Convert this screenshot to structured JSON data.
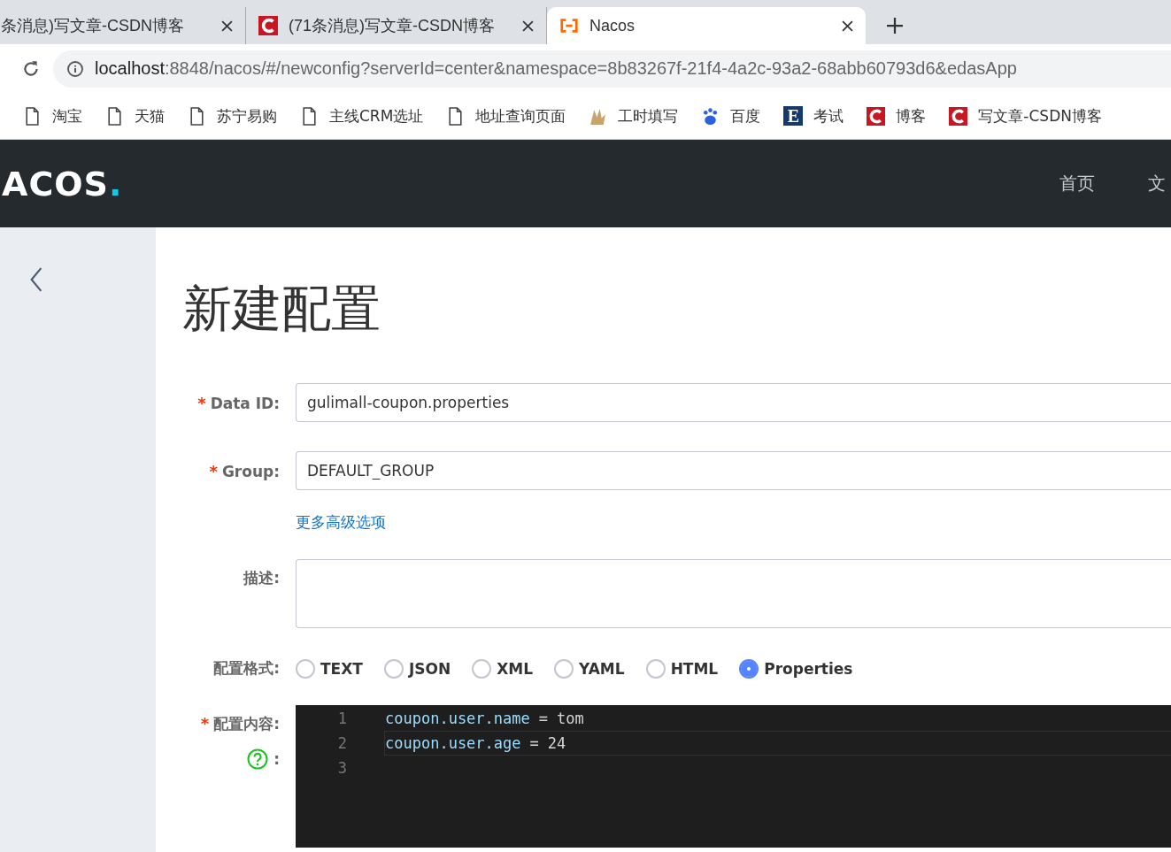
{
  "browser": {
    "tabs": [
      {
        "title": "条消息)写文章-CSDN博客",
        "kind": "plain",
        "selected": false
      },
      {
        "title": "(71条消息)写文章-CSDN博客",
        "kind": "csdn",
        "selected": false
      },
      {
        "title": "Nacos",
        "kind": "nacos",
        "selected": true
      }
    ],
    "address": {
      "host": "localhost",
      "path": ":8848/nacos/#/newconfig?serverId=center&namespace=8b83267f-21f4-4a2c-93a2-68abb60793d6&edasApp"
    },
    "bookmarks": [
      {
        "label": "淘宝",
        "kind": "page"
      },
      {
        "label": "天猫",
        "kind": "page"
      },
      {
        "label": "苏宁易购",
        "kind": "page"
      },
      {
        "label": "主线CRM选址",
        "kind": "page"
      },
      {
        "label": "地址查询页面",
        "kind": "page"
      },
      {
        "label": "工时填写",
        "kind": "artwork"
      },
      {
        "label": "百度",
        "kind": "paw"
      },
      {
        "label": "考试",
        "kind": "letter",
        "letter": "E"
      },
      {
        "label": "博客",
        "kind": "csdn"
      },
      {
        "label": "写文章-CSDN博客",
        "kind": "csdn"
      }
    ]
  },
  "header": {
    "logo": "ACOS",
    "logo_dot": ".",
    "nav": [
      "首页",
      "文"
    ]
  },
  "page": {
    "title": "新建配置",
    "fields": [
      {
        "label": "Data ID:",
        "required_mark": "*",
        "value": "gulimall-coupon.properties"
      },
      {
        "label": "Group:",
        "required_mark": "*",
        "value": "DEFAULT_GROUP"
      }
    ],
    "advanced_link": "更多高级选项",
    "description": {
      "label": "描述:"
    },
    "format": {
      "label": "配置格式:",
      "options": [
        {
          "label": "TEXT",
          "selected": false
        },
        {
          "label": "JSON",
          "selected": false
        },
        {
          "label": "XML",
          "selected": false
        },
        {
          "label": "YAML",
          "selected": false
        },
        {
          "label": "HTML",
          "selected": false
        },
        {
          "label": "Properties",
          "selected": true
        }
      ]
    },
    "content": {
      "label": "配置内容:",
      "required_mark": "*",
      "help_suffix": ":",
      "lines": [
        {
          "number": "1",
          "key": "coupon.user.name",
          "op": "=",
          "value": "tom",
          "selected": false
        },
        {
          "number": "2",
          "key": "coupon.user.age",
          "op": "=",
          "value": "24",
          "selected": true
        },
        {
          "number": "3",
          "selected": false
        }
      ]
    }
  }
}
